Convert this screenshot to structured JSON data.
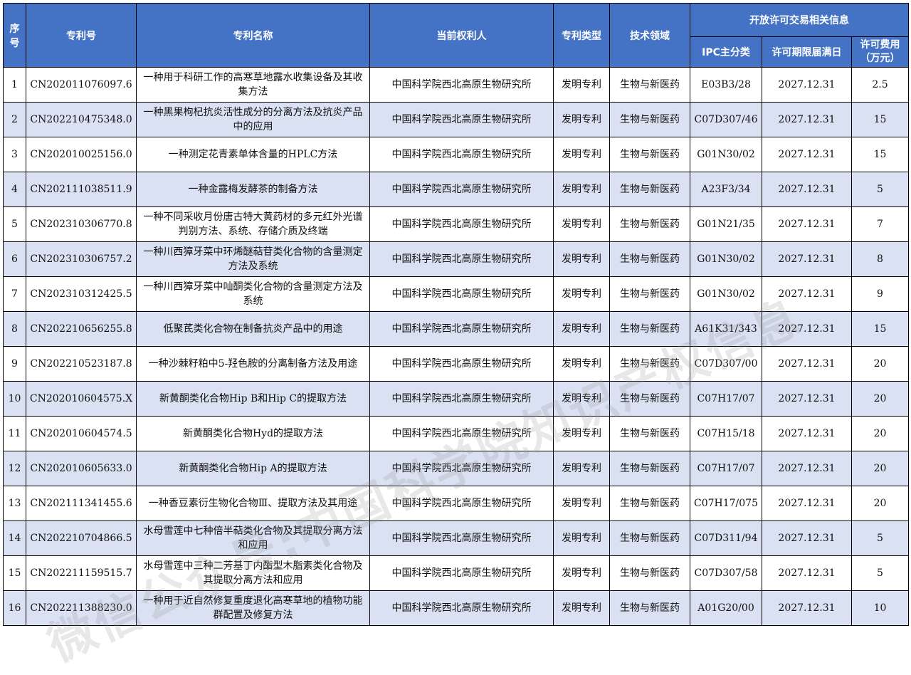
{
  "headers": {
    "seq": "序号",
    "patent_no": "专利号",
    "patent_name": "专利名称",
    "holder": "当前权利人",
    "patent_type": "专利类型",
    "tech_field": "技术领域",
    "license_group": "开放许可交易相关信息",
    "ipc": "IPC主分类",
    "expiry": "许可期限届满日",
    "fee": "许可费用（万元）"
  },
  "rows": [
    {
      "seq": "1",
      "patent_no": "CN202011076097.6",
      "name": "一种用于科研工作的高寒草地露水收集设备及其收集方法",
      "holder": "中国科学院西北高原生物研究所",
      "type": "发明专利",
      "field": "生物与新医药",
      "ipc": "E03B3/28",
      "expiry": "2027.12.31",
      "fee": "2.5"
    },
    {
      "seq": "2",
      "patent_no": "CN202210475348.0",
      "name": "一种黑果枸杞抗炎活性成分的分离方法及抗炎产品中的应用",
      "holder": "中国科学院西北高原生物研究所",
      "type": "发明专利",
      "field": "生物与新医药",
      "ipc": "C07D307/46",
      "expiry": "2027.12.31",
      "fee": "15"
    },
    {
      "seq": "3",
      "patent_no": "CN202010025156.0",
      "name": "一种测定花青素单体含量的HPLC方法",
      "holder": "中国科学院西北高原生物研究所",
      "type": "发明专利",
      "field": "生物与新医药",
      "ipc": "G01N30/02",
      "expiry": "2027.12.31",
      "fee": "15"
    },
    {
      "seq": "4",
      "patent_no": "CN202111038511.9",
      "name": "一种金露梅发酵茶的制备方法",
      "holder": "中国科学院西北高原生物研究所",
      "type": "发明专利",
      "field": "生物与新医药",
      "ipc": "A23F3/34",
      "expiry": "2027.12.31",
      "fee": "5"
    },
    {
      "seq": "5",
      "patent_no": "CN202310306770.8",
      "name": "一种不同采收月份唐古特大黄药材的多元红外光谱判别方法、系统、存储介质及终端",
      "holder": "中国科学院西北高原生物研究所",
      "type": "发明专利",
      "field": "生物与新医药",
      "ipc": "G01N21/35",
      "expiry": "2027.12.31",
      "fee": "7"
    },
    {
      "seq": "6",
      "patent_no": "CN202310306757.2",
      "name": "一种川西獐牙菜中环烯醚萜苷类化合物的含量测定方法及系统",
      "holder": "中国科学院西北高原生物研究所",
      "type": "发明专利",
      "field": "生物与新医药",
      "ipc": "G01N30/02",
      "expiry": "2027.12.31",
      "fee": "8"
    },
    {
      "seq": "7",
      "patent_no": "CN202310312425.5",
      "name": "一种川西獐牙菜中𠮿酮类化合物的含量测定方法及系统",
      "holder": "中国科学院西北高原生物研究所",
      "type": "发明专利",
      "field": "生物与新医药",
      "ipc": "G01N30/02",
      "expiry": "2027.12.31",
      "fee": "9"
    },
    {
      "seq": "8",
      "patent_no": "CN202210656255.8",
      "name": "低聚茋类化合物在制备抗炎产品中的用途",
      "holder": "中国科学院西北高原生物研究所",
      "type": "发明专利",
      "field": "生物与新医药",
      "ipc": "A61K31/343",
      "expiry": "2027.12.31",
      "fee": "15"
    },
    {
      "seq": "9",
      "patent_no": "CN202210523187.8",
      "name": "一种沙棘籽粕中5-羟色胺的分离制备方法及用途",
      "holder": "中国科学院西北高原生物研究所",
      "type": "发明专利",
      "field": "生物与新医药",
      "ipc": "C07D307/00",
      "expiry": "2027.12.31",
      "fee": "20"
    },
    {
      "seq": "10",
      "patent_no": "CN202010604575.X",
      "name": "新黄酮类化合物Hip B和Hip C的提取方法",
      "holder": "中国科学院西北高原生物研究所",
      "type": "发明专利",
      "field": "生物与新医药",
      "ipc": "C07H17/07",
      "expiry": "2027.12.31",
      "fee": "20"
    },
    {
      "seq": "11",
      "patent_no": "CN202010604574.5",
      "name": "新黄酮类化合物Hyd的提取方法",
      "holder": "中国科学院西北高原生物研究所",
      "type": "发明专利",
      "field": "生物与新医药",
      "ipc": "C07H15/18",
      "expiry": "2027.12.31",
      "fee": "20"
    },
    {
      "seq": "12",
      "patent_no": "CN202010605633.0",
      "name": "新黄酮类化合物Hip A的提取方法",
      "holder": "中国科学院西北高原生物研究所",
      "type": "发明专利",
      "field": "生物与新医药",
      "ipc": "C07H17/07",
      "expiry": "2027.12.31",
      "fee": "20"
    },
    {
      "seq": "13",
      "patent_no": "CN202111341455.6",
      "name": "一种香豆素衍生物化合物Ⅲ、提取方法及其用途",
      "holder": "中国科学院西北高原生物研究所",
      "type": "发明专利",
      "field": "生物与新医药",
      "ipc": "C07H17/075",
      "expiry": "2027.12.31",
      "fee": "20"
    },
    {
      "seq": "14",
      "patent_no": "CN202210704866.5",
      "name": "水母雪莲中七种倍半萜类化合物及其提取分离方法和应用",
      "holder": "中国科学院西北高原生物研究所",
      "type": "发明专利",
      "field": "生物与新医药",
      "ipc": "C07D311/94",
      "expiry": "2027.12.31",
      "fee": "5"
    },
    {
      "seq": "15",
      "patent_no": "CN202211159515.7",
      "name": "水母雪莲中三种二芳基丁内酯型木脂素类化合物及其提取分离方法和应用",
      "holder": "中国科学院西北高原生物研究所",
      "type": "发明专利",
      "field": "生物与新医药",
      "ipc": "C07D307/58",
      "expiry": "2027.12.31",
      "fee": "5"
    },
    {
      "seq": "16",
      "patent_no": "CN202211388230.0",
      "name": "一种用于近自然修复重度退化高寒草地的植物功能群配置及修复方法",
      "holder": "中国科学院西北高原生物研究所",
      "type": "发明专利",
      "field": "生物与新医药",
      "ipc": "A01G20/00",
      "expiry": "2027.12.31",
      "fee": "10"
    }
  ],
  "watermark": "微信公众号:中国科学院知识产权信息",
  "colors": {
    "header_bg": "#4472c4",
    "stripe_bg": "#d9e1f2"
  }
}
